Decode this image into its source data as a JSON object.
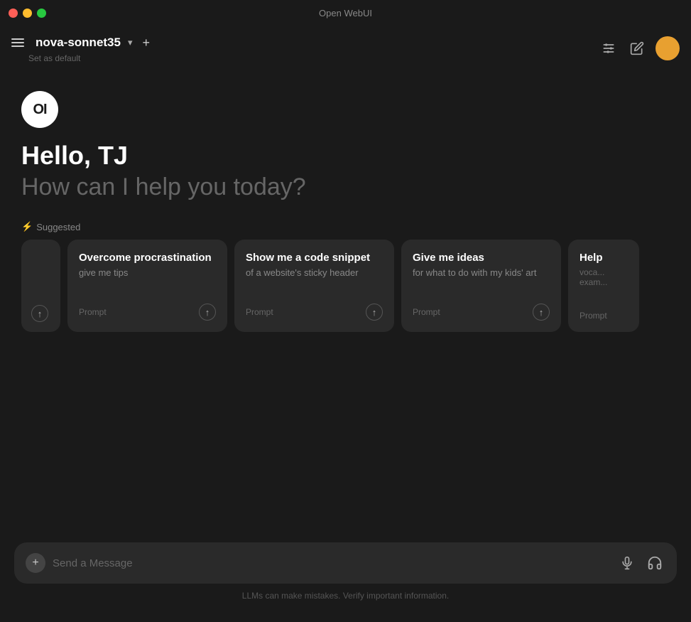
{
  "window": {
    "title": "Open WebUI"
  },
  "traffic_lights": {
    "close": "close",
    "minimize": "minimize",
    "maximize": "maximize"
  },
  "toolbar": {
    "model_name": "nova-sonnet35",
    "set_default_label": "Set as default",
    "add_label": "+",
    "hamburger_label": "menu"
  },
  "greeting": {
    "logo_text": "OI",
    "hello_label": "Hello, TJ",
    "subtitle_label": "How can I help you today?"
  },
  "suggested": {
    "label": "Suggested",
    "cards": [
      {
        "title": "Overcome procrastination",
        "subtitle": "give me tips",
        "prompt_label": "Prompt"
      },
      {
        "title": "Show me a code snippet",
        "subtitle": "of a website's sticky header",
        "prompt_label": "Prompt"
      },
      {
        "title": "Give me ideas",
        "subtitle": "for what to do with my kids' art",
        "prompt_label": "Prompt"
      },
      {
        "title": "Help",
        "subtitle": "voca... exam...",
        "prompt_label": "Prompt"
      }
    ]
  },
  "input": {
    "placeholder": "Send a Message",
    "add_label": "+",
    "mic_label": "microphone",
    "headphones_label": "headphones"
  },
  "disclaimer": {
    "text": "LLMs can make mistakes. Verify important information."
  }
}
